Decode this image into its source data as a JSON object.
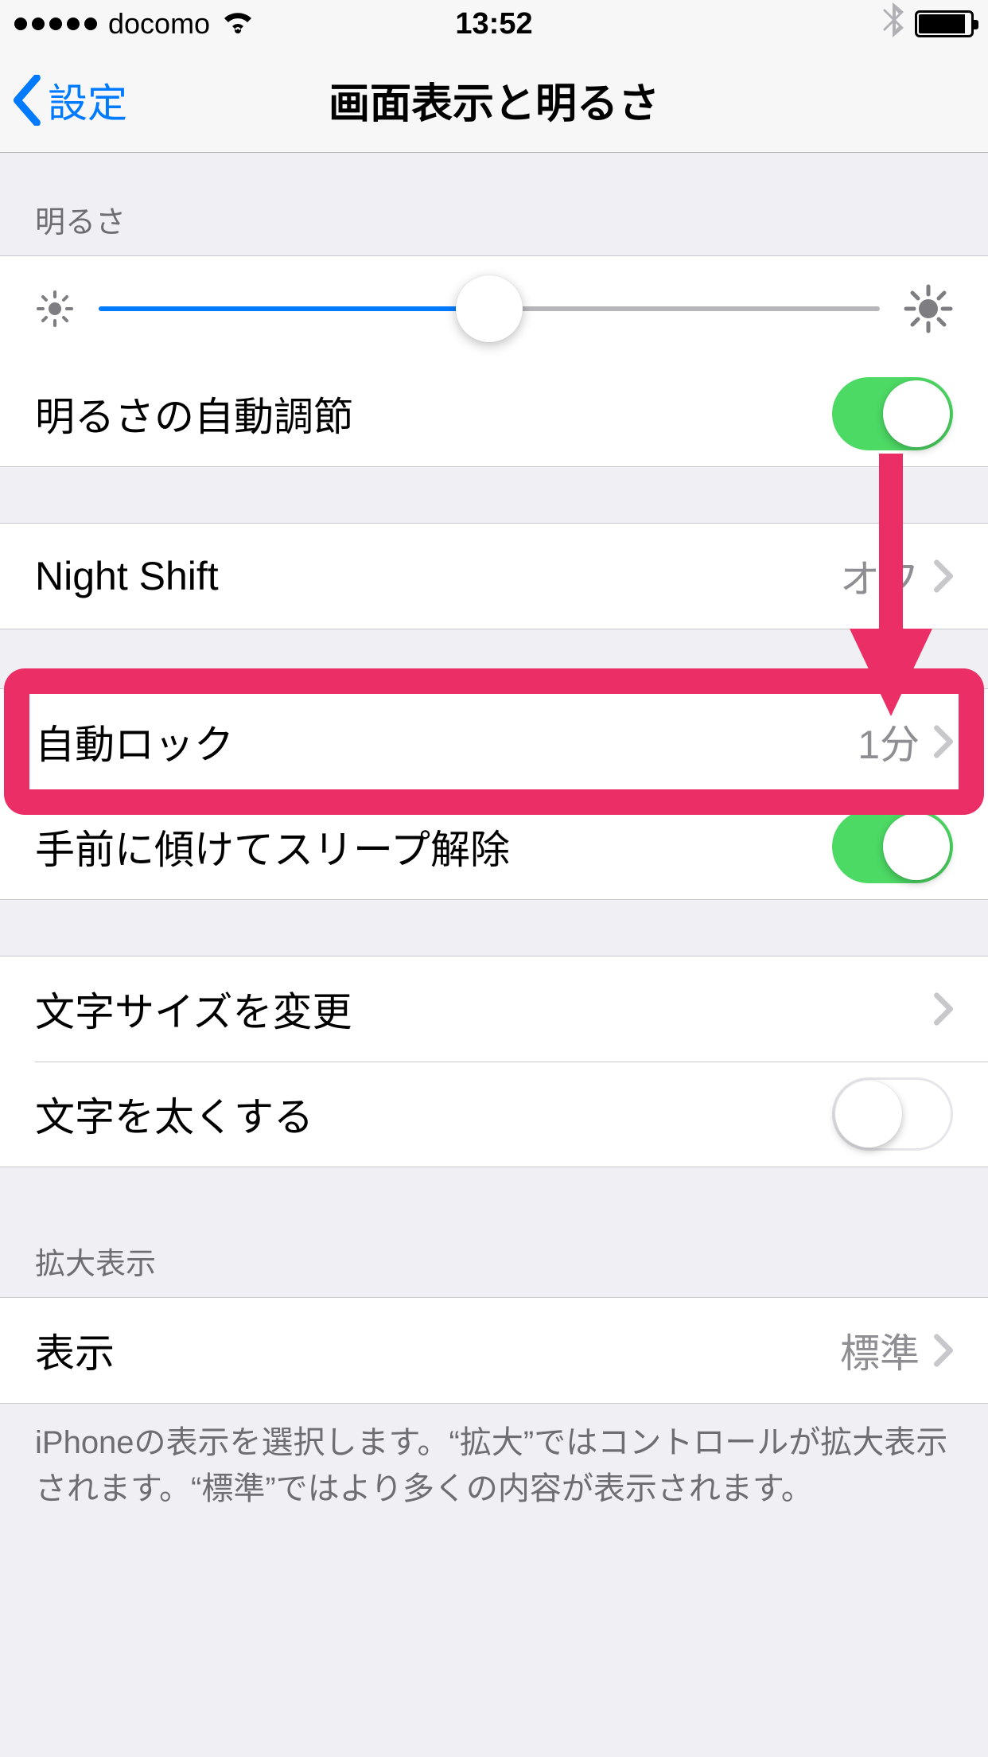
{
  "status": {
    "carrier": "docomo",
    "time": "13:52"
  },
  "nav": {
    "back_label": "設定",
    "title": "画面表示と明るさ"
  },
  "sections": {
    "brightness_header": "明るさ",
    "brightness_slider_percent": 50,
    "auto_brightness_label": "明るさの自動調節",
    "auto_brightness_on": true,
    "night_shift_label": "Night Shift",
    "night_shift_value": "オフ",
    "auto_lock_label": "自動ロック",
    "auto_lock_value": "1分",
    "raise_to_wake_label": "手前に傾けてスリープ解除",
    "raise_to_wake_on": true,
    "text_size_label": "文字サイズを変更",
    "bold_text_label": "文字を太くする",
    "bold_text_on": false,
    "zoom_header": "拡大表示",
    "view_label": "表示",
    "view_value": "標準",
    "zoom_footer": "iPhoneの表示を選択します。“拡大”ではコントロールが拡大表示されます。“標準”ではより多くの内容が表示されます。"
  },
  "annotation": {
    "highlight_color": "#eb2e66"
  }
}
